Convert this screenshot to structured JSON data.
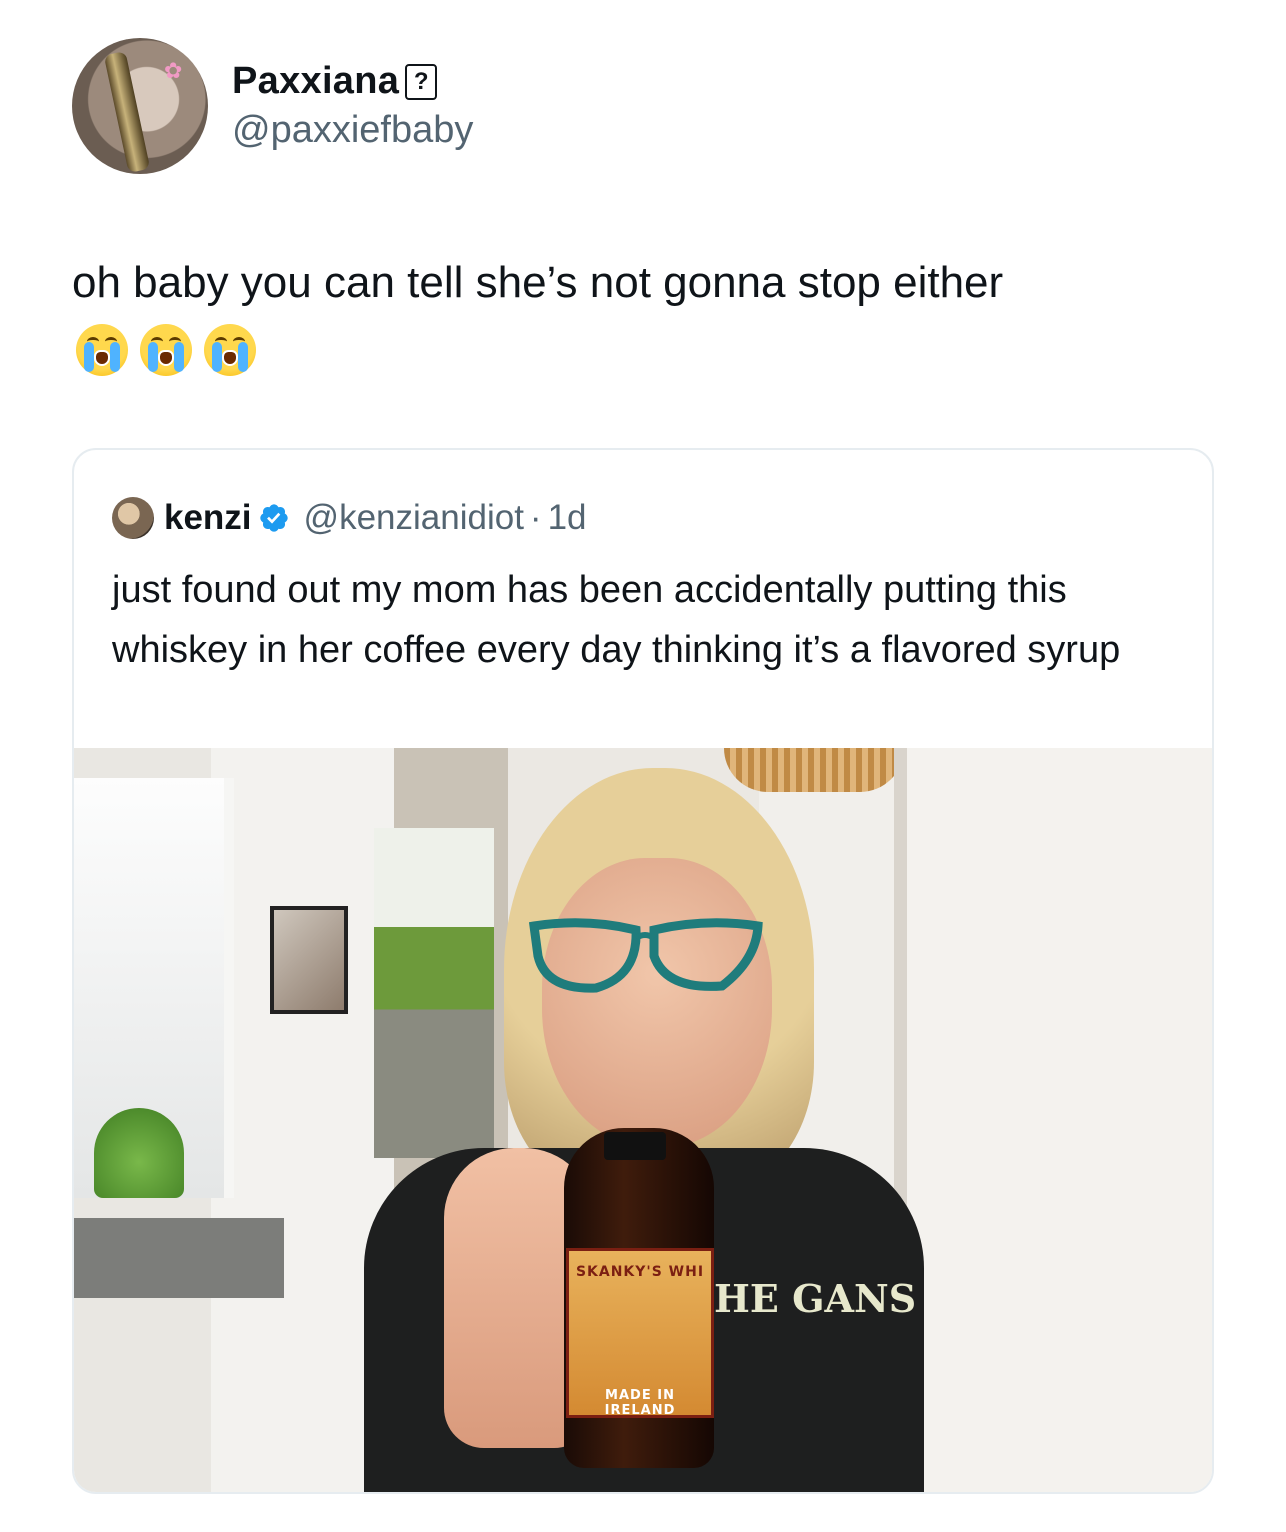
{
  "tweet": {
    "author": {
      "display_name": "Paxxiana",
      "name_glyph": "?",
      "handle": "@paxxiefbaby"
    },
    "text": "oh baby you can tell she’s not gonna stop either",
    "emoji": [
      "loudly-crying-face",
      "loudly-crying-face",
      "loudly-crying-face"
    ]
  },
  "quoted": {
    "author": {
      "display_name": "kenzi",
      "handle": "@kenzianidiot",
      "separator": "·",
      "time": "1d"
    },
    "text": "just found out my mom has been accidentally putting this whiskey in her coffee every day thinking it’s a flavored syrup",
    "media": {
      "bottle_label_top": "SKANKY'S WHI",
      "bottle_label_bottom": "MADE IN IRELAND",
      "shirt_text": "HE GANS"
    }
  },
  "colors": {
    "text": "#0f1419",
    "secondary": "#536471",
    "border": "#e6ecf0",
    "verified": "#1d9bf0"
  }
}
